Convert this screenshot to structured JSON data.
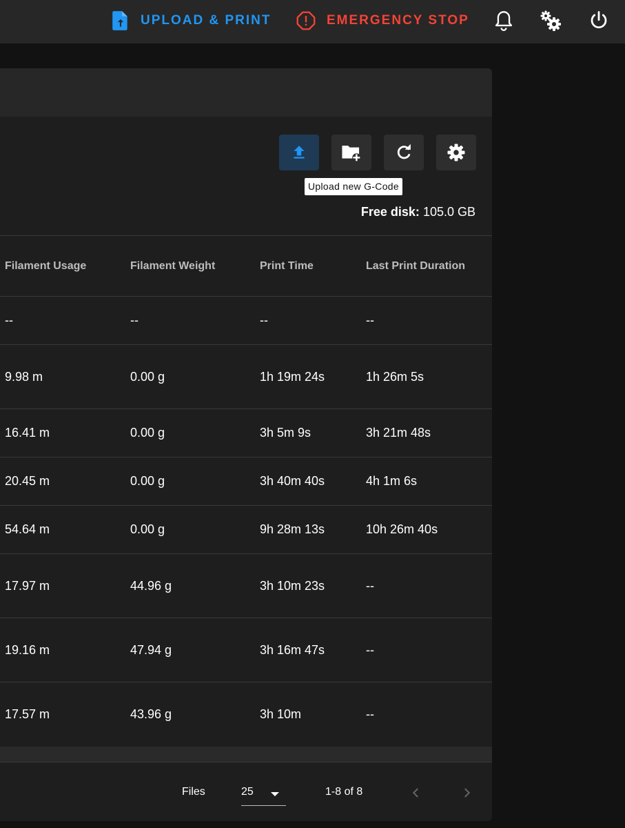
{
  "appbar": {
    "upload_print": "UPLOAD & PRINT",
    "emergency_stop": "EMERGENCY STOP",
    "icons": [
      "bell-icon",
      "gears-icon",
      "power-icon"
    ]
  },
  "toolbar": {
    "icons": [
      "upload-icon",
      "folder-plus-icon",
      "refresh-icon",
      "gear-icon"
    ],
    "tooltip": "Upload new G-Code",
    "free_disk_label": "Free disk:",
    "free_disk_value": "105.0 GB"
  },
  "table": {
    "headers": [
      "Filament Usage",
      "Filament Weight",
      "Print Time",
      "Last Print Duration"
    ],
    "rows": [
      [
        "--",
        "--",
        "--",
        "--"
      ],
      [
        "9.98 m",
        "0.00 g",
        "1h 19m 24s",
        "1h 26m 5s"
      ],
      [
        "16.41 m",
        "0.00 g",
        "3h 5m 9s",
        "3h 21m 48s"
      ],
      [
        "20.45 m",
        "0.00 g",
        "3h 40m 40s",
        "4h 1m 6s"
      ],
      [
        "54.64 m",
        "0.00 g",
        "9h 28m 13s",
        "10h 26m 40s"
      ],
      [
        "17.97 m",
        "44.96 g",
        "3h 10m 23s",
        "--"
      ],
      [
        "19.16 m",
        "47.94 g",
        "3h 16m 47s",
        "--"
      ],
      [
        "17.57 m",
        "43.96 g",
        "3h 10m",
        "--"
      ]
    ]
  },
  "pager": {
    "label": "Files",
    "per_page": "25",
    "range": "1-8 of 8"
  },
  "colors": {
    "accent": "#2196f3",
    "danger": "#f44336"
  }
}
